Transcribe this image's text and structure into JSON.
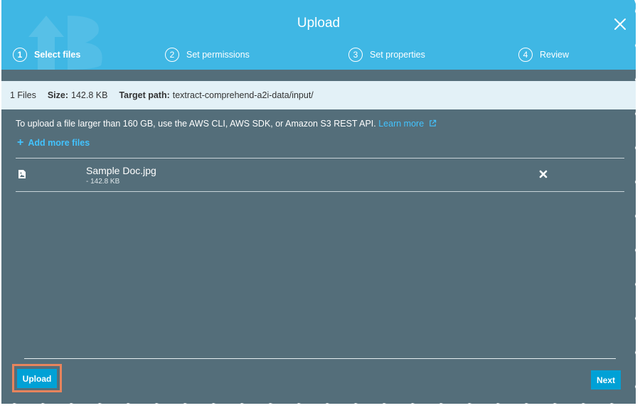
{
  "dialog": {
    "title": "Upload",
    "steps": [
      {
        "number": "1",
        "label": "Select files",
        "active": true
      },
      {
        "number": "2",
        "label": "Set permissions",
        "active": false
      },
      {
        "number": "3",
        "label": "Set properties",
        "active": false
      },
      {
        "number": "4",
        "label": "Review",
        "active": false
      }
    ]
  },
  "summary": {
    "files_count": "1 Files",
    "size_label": "Size:",
    "size_value": "142.8 KB",
    "target_label": "Target path:",
    "target_value": "textract-comprehend-a2i-data/input/"
  },
  "notice": {
    "text": "To upload a file larger than 160 GB, use the AWS CLI, AWS SDK, or Amazon S3 REST API.",
    "learn_more": "Learn more"
  },
  "add_more_files": "Add more files",
  "files": [
    {
      "name": "Sample Doc.jpg",
      "size": "- 142.8 KB"
    }
  ],
  "footer": {
    "upload_label": "Upload",
    "next_label": "Next"
  },
  "colors": {
    "header": "#3fb7e4",
    "body": "#546e7a",
    "accent": "#00a1d6",
    "link": "#42c3ff",
    "highlight": "#e8845c"
  }
}
